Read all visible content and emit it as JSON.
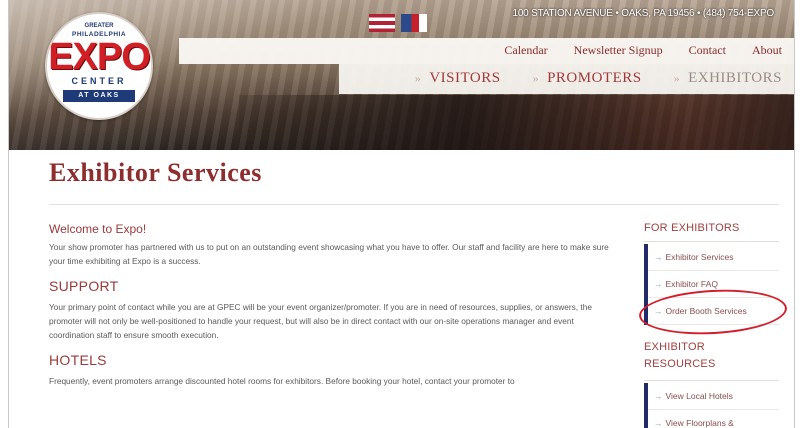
{
  "header": {
    "address": "100 STATION AVENUE • OAKS, PA 19456 • (484) 754-EXPO",
    "logo": {
      "line1": "GREATER",
      "line2": "PHILADELPHIA",
      "brand": "EXPO",
      "sub": "CENTER",
      "location": "AT OAKS"
    },
    "top_nav": [
      "Calendar",
      "Newsletter Signup",
      "Contact",
      "About"
    ],
    "main_nav": [
      {
        "label": "VISITORS",
        "active": false
      },
      {
        "label": "PROMOTERS",
        "active": false
      },
      {
        "label": "EXHIBITORS",
        "active": true
      }
    ],
    "nav_arrow": "»"
  },
  "page": {
    "title": "Exhibitor Services"
  },
  "content": {
    "welcome_heading": "Welcome to Expo!",
    "welcome_text": "Your show promoter has partnered with us to put on an outstanding event showcasing what you have to offer. Our staff and facility are here to make sure your time exhibiting at Expo is a success.",
    "support_heading": "SUPPORT",
    "support_text": "Your primary point of contact while you are at GPEC will be your event organizer/promoter. If you are in need of resources, supplies, or answers, the promoter will not only be well-positioned to handle your request, but will also be in direct contact with our on-site operations manager and event coordination staff to ensure smooth execution.",
    "hotels_heading": "HOTELS",
    "hotels_text": "Frequently, event promoters arrange discounted hotel rooms for exhibitors. Before booking your hotel, contact your promoter to"
  },
  "sidebar": {
    "for_exhibitors_heading": "FOR EXHIBITORS",
    "for_exhibitors_links": [
      "Exhibitor Services",
      "Exhibitor FAQ",
      "Order Booth Services"
    ],
    "resources_heading_1": "EXHIBITOR",
    "resources_heading_2": "RESOURCES",
    "resources_links": [
      "View Local Hotels",
      "View Floorplans &"
    ],
    "link_arrow": "→"
  },
  "colors": {
    "brand_red": "#8e2d2d",
    "accent_navy": "#222a6a",
    "annotation_red": "#d41d2a"
  }
}
